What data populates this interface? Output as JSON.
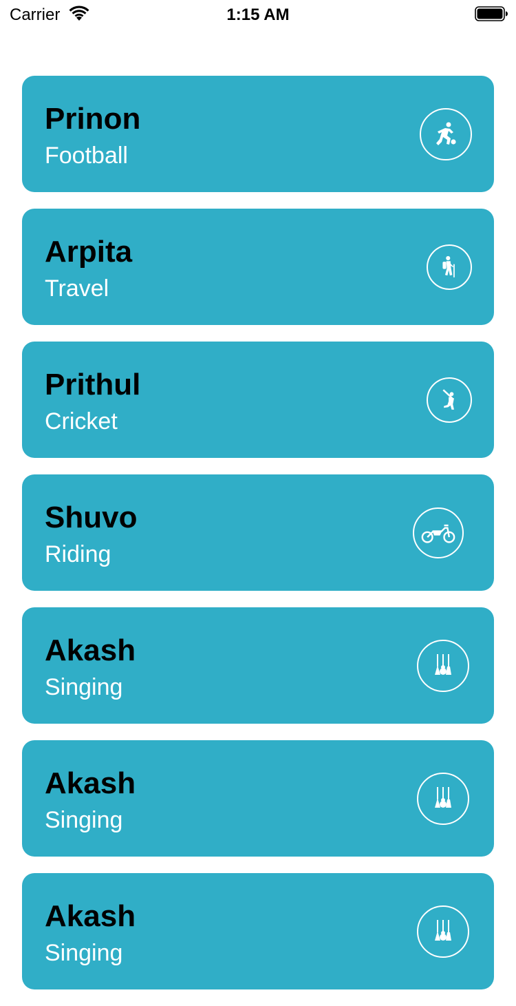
{
  "status_bar": {
    "carrier": "Carrier",
    "time": "1:15 AM"
  },
  "items": [
    {
      "name": "Prinon",
      "hobby": "Football",
      "icon": "football-player-icon"
    },
    {
      "name": "Arpita",
      "hobby": "Travel",
      "icon": "hiker-icon"
    },
    {
      "name": "Prithul",
      "hobby": "Cricket",
      "icon": "cricket-batsman-icon"
    },
    {
      "name": "Shuvo",
      "hobby": "Riding",
      "icon": "motorbike-icon"
    },
    {
      "name": "Akash",
      "hobby": "Singing",
      "icon": "guitars-icon"
    },
    {
      "name": "Akash",
      "hobby": "Singing",
      "icon": "guitars-icon"
    },
    {
      "name": "Akash",
      "hobby": "Singing",
      "icon": "guitars-icon"
    }
  ],
  "colors": {
    "card_background": "#30aec7",
    "name_text": "#000000",
    "hobby_text": "#ffffff",
    "page_background": "#ffffff"
  }
}
